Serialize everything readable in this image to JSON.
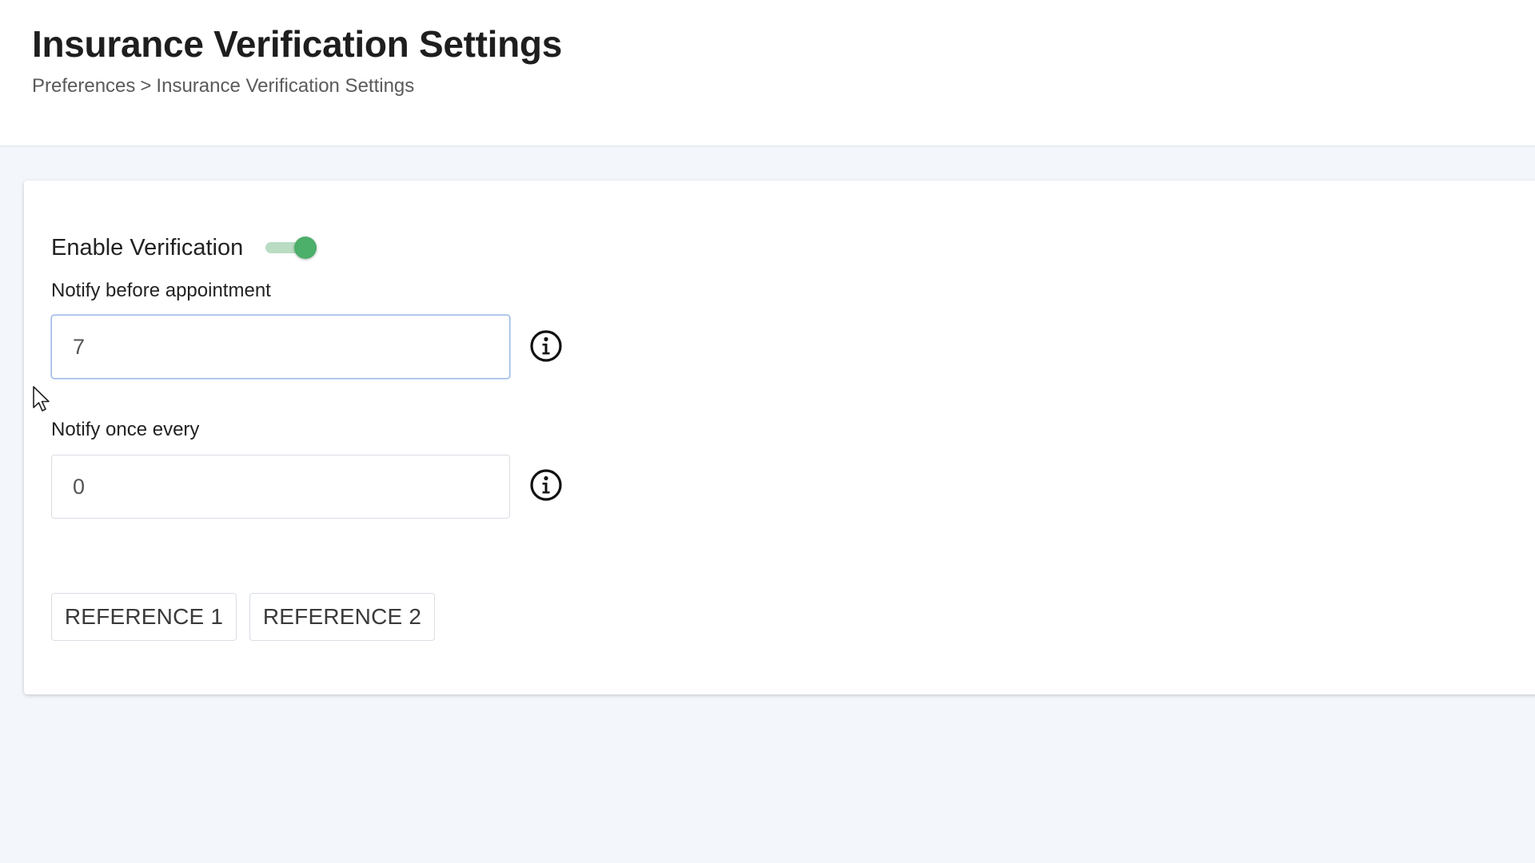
{
  "header": {
    "title": "Insurance Verification Settings",
    "breadcrumb": {
      "parent": "Preferences",
      "separator": ">",
      "current": "Insurance Verification Settings"
    }
  },
  "settings": {
    "enable_verification": {
      "label": "Enable Verification",
      "checked": true
    },
    "notify_before": {
      "label": "Notify before appointment",
      "value": "7",
      "info_icon": "info-icon"
    },
    "notify_every": {
      "label": "Notify once every",
      "value": "0",
      "info_icon": "info-icon"
    },
    "buttons": {
      "reference1": "REFERENCE 1",
      "reference2": "REFERENCE 2"
    }
  },
  "colors": {
    "toggle_on": "#4caf6a",
    "toggle_track": "#b9dcc3",
    "page_background": "#f3f6fb",
    "focus_border": "#9cb8e3"
  }
}
